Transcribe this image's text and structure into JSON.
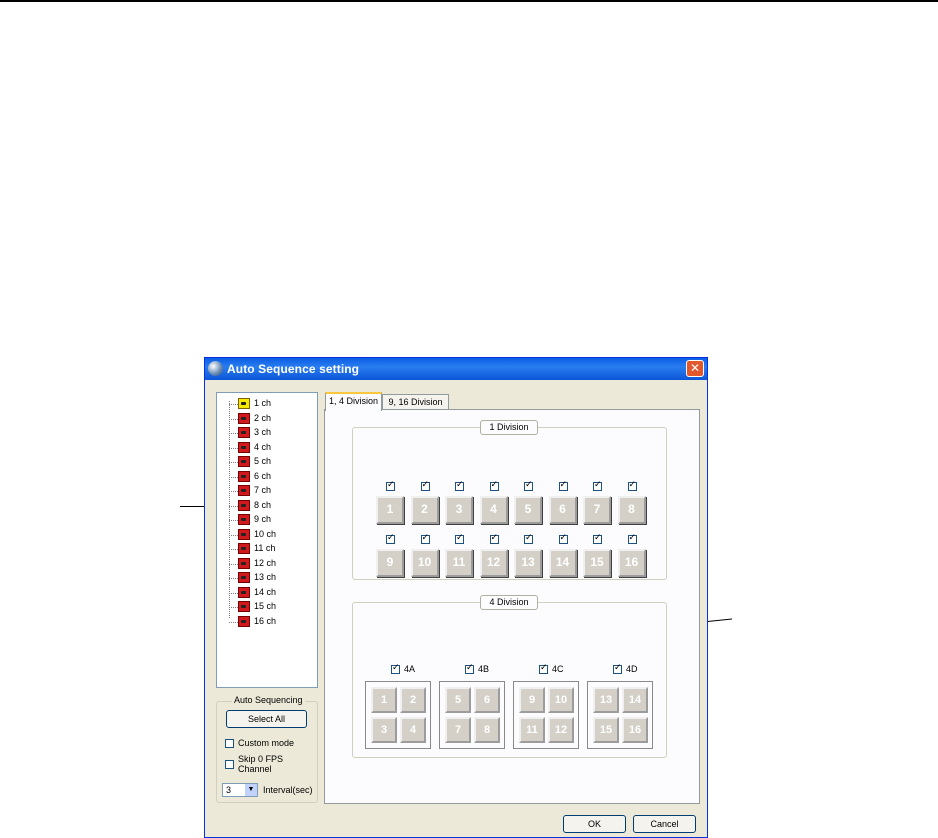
{
  "window": {
    "title": "Auto Sequence setting",
    "close_symbol": "✕"
  },
  "tree": {
    "items": [
      {
        "label": "1 ch",
        "status": "yellow"
      },
      {
        "label": "2 ch",
        "status": "red"
      },
      {
        "label": "3 ch",
        "status": "red"
      },
      {
        "label": "4 ch",
        "status": "red"
      },
      {
        "label": "5 ch",
        "status": "red"
      },
      {
        "label": "6 ch",
        "status": "red"
      },
      {
        "label": "7 ch",
        "status": "red"
      },
      {
        "label": "8 ch",
        "status": "red"
      },
      {
        "label": "9 ch",
        "status": "red"
      },
      {
        "label": "10 ch",
        "status": "red"
      },
      {
        "label": "11 ch",
        "status": "red"
      },
      {
        "label": "12 ch",
        "status": "red"
      },
      {
        "label": "13 ch",
        "status": "red"
      },
      {
        "label": "14 ch",
        "status": "red"
      },
      {
        "label": "15 ch",
        "status": "red"
      },
      {
        "label": "16 ch",
        "status": "red"
      }
    ]
  },
  "auto_sequencing": {
    "title": "Auto Sequencing",
    "select_all_label": "Select All",
    "custom_mode_label": "Custom mode",
    "custom_mode_checked": false,
    "skip_fps_label_line1": "Skip 0 FPS",
    "skip_fps_label_line2": "Channel",
    "skip_fps_checked": false,
    "interval_value": "3",
    "interval_label": "Interval(sec)",
    "dropdown_arrow": "▼"
  },
  "tabs": [
    {
      "label": "1, 4 Division",
      "active": true
    },
    {
      "label": "9, 16 Division",
      "active": false
    }
  ],
  "division1": {
    "title": "1 Division",
    "channels": [
      "1",
      "2",
      "3",
      "4",
      "5",
      "6",
      "7",
      "8",
      "9",
      "10",
      "11",
      "12",
      "13",
      "14",
      "15",
      "16"
    ],
    "checked": [
      true,
      true,
      true,
      true,
      true,
      true,
      true,
      true,
      true,
      true,
      true,
      true,
      true,
      true,
      true,
      true
    ]
  },
  "division4": {
    "title": "4 Division",
    "groups": [
      {
        "label": "4A",
        "checked": true,
        "channels": [
          "1",
          "2",
          "3",
          "4"
        ]
      },
      {
        "label": "4B",
        "checked": true,
        "channels": [
          "5",
          "6",
          "7",
          "8"
        ]
      },
      {
        "label": "4C",
        "checked": true,
        "channels": [
          "9",
          "10",
          "11",
          "12"
        ]
      },
      {
        "label": "4D",
        "checked": true,
        "channels": [
          "13",
          "14",
          "15",
          "16"
        ]
      }
    ]
  },
  "buttons": {
    "ok_label": "OK",
    "cancel_label": "Cancel"
  }
}
